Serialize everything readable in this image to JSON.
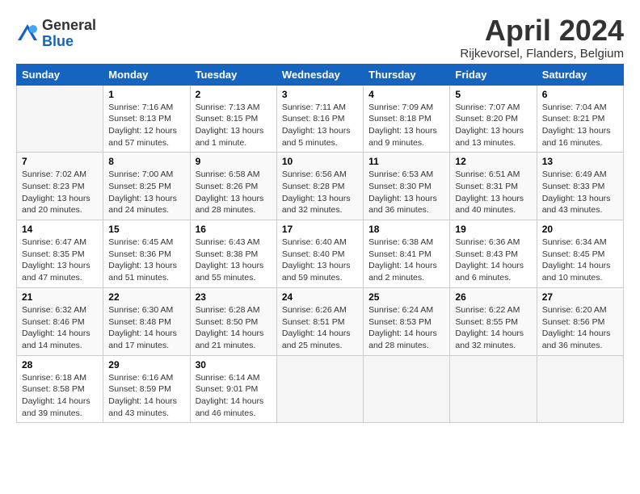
{
  "logo": {
    "general": "General",
    "blue": "Blue"
  },
  "title": "April 2024",
  "location": "Rijkevorsel, Flanders, Belgium",
  "days_of_week": [
    "Sunday",
    "Monday",
    "Tuesday",
    "Wednesday",
    "Thursday",
    "Friday",
    "Saturday"
  ],
  "weeks": [
    [
      {
        "day": "",
        "info": ""
      },
      {
        "day": "1",
        "info": "Sunrise: 7:16 AM\nSunset: 8:13 PM\nDaylight: 12 hours\nand 57 minutes."
      },
      {
        "day": "2",
        "info": "Sunrise: 7:13 AM\nSunset: 8:15 PM\nDaylight: 13 hours\nand 1 minute."
      },
      {
        "day": "3",
        "info": "Sunrise: 7:11 AM\nSunset: 8:16 PM\nDaylight: 13 hours\nand 5 minutes."
      },
      {
        "day": "4",
        "info": "Sunrise: 7:09 AM\nSunset: 8:18 PM\nDaylight: 13 hours\nand 9 minutes."
      },
      {
        "day": "5",
        "info": "Sunrise: 7:07 AM\nSunset: 8:20 PM\nDaylight: 13 hours\nand 13 minutes."
      },
      {
        "day": "6",
        "info": "Sunrise: 7:04 AM\nSunset: 8:21 PM\nDaylight: 13 hours\nand 16 minutes."
      }
    ],
    [
      {
        "day": "7",
        "info": "Sunrise: 7:02 AM\nSunset: 8:23 PM\nDaylight: 13 hours\nand 20 minutes."
      },
      {
        "day": "8",
        "info": "Sunrise: 7:00 AM\nSunset: 8:25 PM\nDaylight: 13 hours\nand 24 minutes."
      },
      {
        "day": "9",
        "info": "Sunrise: 6:58 AM\nSunset: 8:26 PM\nDaylight: 13 hours\nand 28 minutes."
      },
      {
        "day": "10",
        "info": "Sunrise: 6:56 AM\nSunset: 8:28 PM\nDaylight: 13 hours\nand 32 minutes."
      },
      {
        "day": "11",
        "info": "Sunrise: 6:53 AM\nSunset: 8:30 PM\nDaylight: 13 hours\nand 36 minutes."
      },
      {
        "day": "12",
        "info": "Sunrise: 6:51 AM\nSunset: 8:31 PM\nDaylight: 13 hours\nand 40 minutes."
      },
      {
        "day": "13",
        "info": "Sunrise: 6:49 AM\nSunset: 8:33 PM\nDaylight: 13 hours\nand 43 minutes."
      }
    ],
    [
      {
        "day": "14",
        "info": "Sunrise: 6:47 AM\nSunset: 8:35 PM\nDaylight: 13 hours\nand 47 minutes."
      },
      {
        "day": "15",
        "info": "Sunrise: 6:45 AM\nSunset: 8:36 PM\nDaylight: 13 hours\nand 51 minutes."
      },
      {
        "day": "16",
        "info": "Sunrise: 6:43 AM\nSunset: 8:38 PM\nDaylight: 13 hours\nand 55 minutes."
      },
      {
        "day": "17",
        "info": "Sunrise: 6:40 AM\nSunset: 8:40 PM\nDaylight: 13 hours\nand 59 minutes."
      },
      {
        "day": "18",
        "info": "Sunrise: 6:38 AM\nSunset: 8:41 PM\nDaylight: 14 hours\nand 2 minutes."
      },
      {
        "day": "19",
        "info": "Sunrise: 6:36 AM\nSunset: 8:43 PM\nDaylight: 14 hours\nand 6 minutes."
      },
      {
        "day": "20",
        "info": "Sunrise: 6:34 AM\nSunset: 8:45 PM\nDaylight: 14 hours\nand 10 minutes."
      }
    ],
    [
      {
        "day": "21",
        "info": "Sunrise: 6:32 AM\nSunset: 8:46 PM\nDaylight: 14 hours\nand 14 minutes."
      },
      {
        "day": "22",
        "info": "Sunrise: 6:30 AM\nSunset: 8:48 PM\nDaylight: 14 hours\nand 17 minutes."
      },
      {
        "day": "23",
        "info": "Sunrise: 6:28 AM\nSunset: 8:50 PM\nDaylight: 14 hours\nand 21 minutes."
      },
      {
        "day": "24",
        "info": "Sunrise: 6:26 AM\nSunset: 8:51 PM\nDaylight: 14 hours\nand 25 minutes."
      },
      {
        "day": "25",
        "info": "Sunrise: 6:24 AM\nSunset: 8:53 PM\nDaylight: 14 hours\nand 28 minutes."
      },
      {
        "day": "26",
        "info": "Sunrise: 6:22 AM\nSunset: 8:55 PM\nDaylight: 14 hours\nand 32 minutes."
      },
      {
        "day": "27",
        "info": "Sunrise: 6:20 AM\nSunset: 8:56 PM\nDaylight: 14 hours\nand 36 minutes."
      }
    ],
    [
      {
        "day": "28",
        "info": "Sunrise: 6:18 AM\nSunset: 8:58 PM\nDaylight: 14 hours\nand 39 minutes."
      },
      {
        "day": "29",
        "info": "Sunrise: 6:16 AM\nSunset: 8:59 PM\nDaylight: 14 hours\nand 43 minutes."
      },
      {
        "day": "30",
        "info": "Sunrise: 6:14 AM\nSunset: 9:01 PM\nDaylight: 14 hours\nand 46 minutes."
      },
      {
        "day": "",
        "info": ""
      },
      {
        "day": "",
        "info": ""
      },
      {
        "day": "",
        "info": ""
      },
      {
        "day": "",
        "info": ""
      }
    ]
  ]
}
